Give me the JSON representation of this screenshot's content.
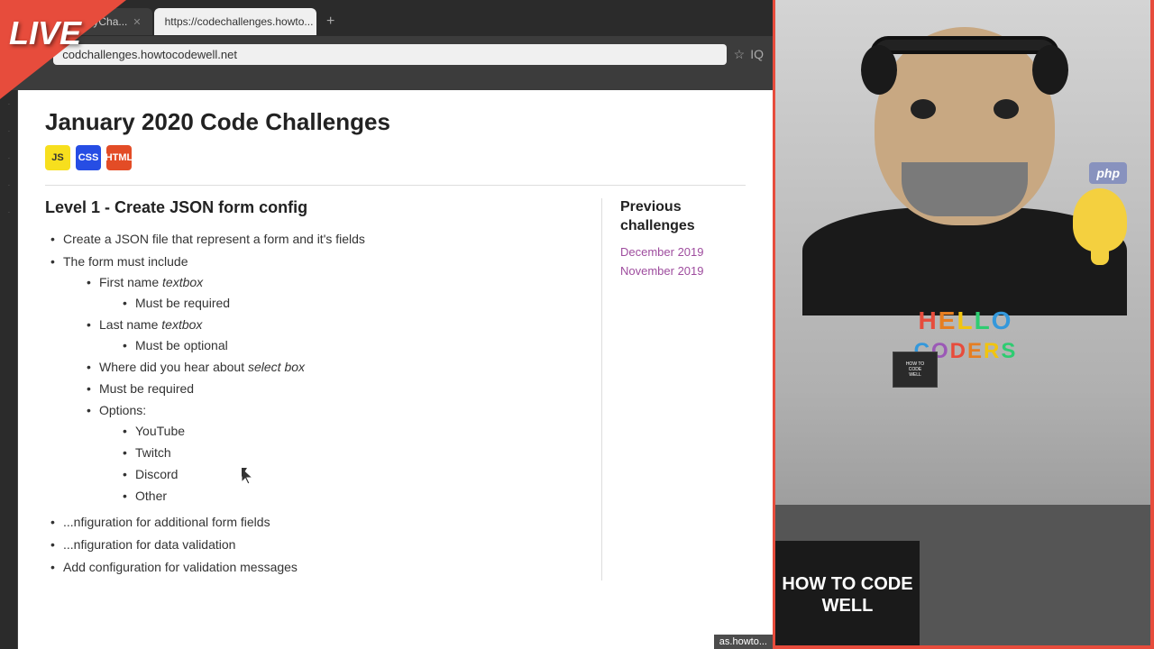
{
  "live_badge": {
    "text": "LIVE"
  },
  "browser": {
    "tabs": [
      {
        "label": "ryrianad/JanuaryCha...",
        "active": false
      },
      {
        "label": "https://codechallenges.howto...",
        "active": true
      }
    ],
    "new_tab_icon": "+",
    "address": "codchallenges.howtocodewell.net",
    "bookmark_icon": "☆",
    "ext_icon": "IQ"
  },
  "sidebar": {
    "items": [
      {
        "label": "..."
      },
      {
        "label": "..."
      },
      {
        "label": "..."
      },
      {
        "label": "..."
      },
      {
        "label": "..."
      }
    ]
  },
  "webpage": {
    "title": "January 2020 Code Challenges",
    "tech_icons": [
      {
        "name": "JS",
        "class": "js",
        "label": "JS"
      },
      {
        "name": "CSS",
        "class": "css",
        "label": "CSS"
      },
      {
        "name": "HTML",
        "class": "html",
        "label": "HTML"
      }
    ],
    "level_title": "Level 1 - Create JSON form config",
    "main_list": [
      {
        "text": "Create a JSON file that represent a form and it's fields",
        "children": []
      },
      {
        "text": "The form must include",
        "children": [
          {
            "text": "First name textbox",
            "italic_part": "textbox",
            "children": [
              {
                "text": "Must be required"
              }
            ]
          },
          {
            "text": "Last name textbox",
            "italic_part": "textbox",
            "children": [
              {
                "text": "Must be optional"
              }
            ]
          },
          {
            "text": "Where did you hear about select box",
            "italic_part": "select box"
          },
          {
            "text": "Must be required"
          },
          {
            "text": "Options:",
            "children": [
              {
                "text": "YouTube"
              },
              {
                "text": "Twitch"
              },
              {
                "text": "Discord"
              },
              {
                "text": "Other"
              }
            ]
          }
        ]
      }
    ],
    "bottom_items": [
      {
        "text": "...nfiguration for additional form fields"
      },
      {
        "text": "...nfiguration for data validation"
      },
      {
        "text": "Add configuration for validation messages"
      }
    ],
    "sidebar": {
      "title": "Previous challenges",
      "links": [
        {
          "text": "December 2019",
          "color": "#9e4c9e"
        },
        {
          "text": "November 2019",
          "color": "#9e4c9e"
        }
      ]
    }
  },
  "person": {
    "shirt_hello": "HELLO",
    "shirt_coders": "CODERS",
    "badge_text": "HOW TO CODE WELL"
  },
  "url_bottom": "as.howto..."
}
